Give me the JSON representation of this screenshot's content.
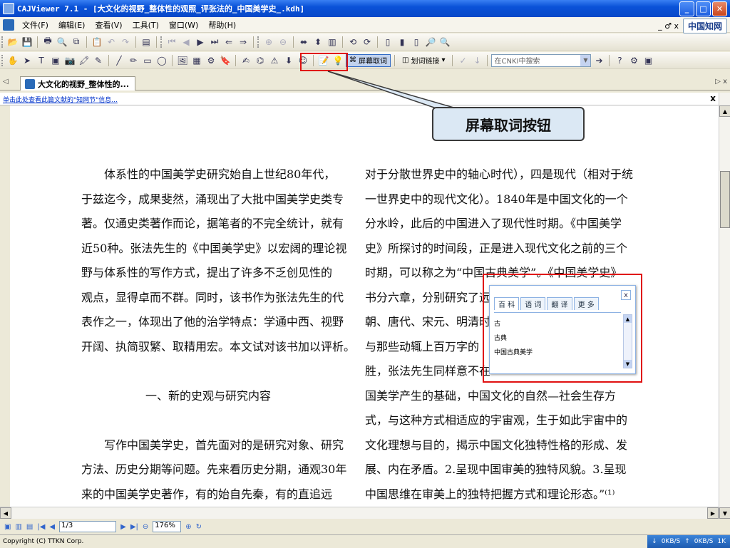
{
  "window": {
    "title": "CAJViewer 7.1 - [大文化的视野_整体性的观照_评张法的_中国美学史_.kdh]",
    "min_label": "_",
    "max_label": "□",
    "close_label": "✕"
  },
  "menu": {
    "items": [
      "文件(F)",
      "编辑(E)",
      "查看(V)",
      "工具(T)",
      "窗口(W)",
      "帮助(H)"
    ],
    "right_controls": "_ ♂ x",
    "cnki_label": "中国知网"
  },
  "toolbar3": {
    "screen_word_label": "屏幕取词",
    "word_link_label": "划词链接",
    "search_placeholder": "在CNKI中搜索"
  },
  "tabs": {
    "active_label": "大文化的视野_整体性的...",
    "left_arrow": "◁",
    "right_controls": "▷ x"
  },
  "infobar": {
    "link_text": "单击此处查看此篇文献的\"知网节\"信息...",
    "close": "x"
  },
  "document": {
    "col1_lines": [
      {
        "text": "体系性的中国美学史研究始自上世纪80年代，",
        "indent": true
      },
      {
        "text": "于兹迄今，成果斐然，涌现出了大批中国美学史类专"
      },
      {
        "text": "著。仅通史类著作而论，据笔者的不完全统计，就有"
      },
      {
        "text": "近50种。张法先生的《中国美学史》以宏阔的理论视"
      },
      {
        "text": "野与体系性的写作方式，提出了许多不乏创见性的"
      },
      {
        "text": "观点，显得卓而不群。同时，该书作为张法先生的代"
      },
      {
        "text": "表作之一，体现出了他的治学特点：学通中西、视野"
      },
      {
        "text": "开阔、执简驭繁、取精用宏。本文试对该书加以评析。"
      }
    ],
    "section_heading": "一、新的史观与研究内容",
    "col1_lines_b": [
      {
        "text": "写作中国美学史，首先面对的是研究对象、研究",
        "indent": true
      },
      {
        "text": "方法、历史分期等问题。先来看历史分期，通观30年"
      },
      {
        "text": "来的中国美学史著作，有的始自先秦，有的直追远"
      }
    ],
    "col2_lines": [
      "对于分散世界史中的轴心时代），四是现代（相对于统",
      "一世界史中的现代文化）。1840年是中国文化的一个",
      "分水岭，此后的中国进入了现代性时期。《中国美学",
      "史》所探讨的时间段，正是进入现代文化之前的三个",
      "时期，可以称之为“中国古典美学”。《中国美学史》",
      "书分六章，分别研究了远",
      "朝、唐代、宋元、明清时期",
      "与那些动辄上百万字的",
      "胜，张法先生同样意不在",
      "国美学产生的基础，中国文化的自然—社会生存方",
      "式，与这种方式相适应的宇宙观，生于如此宇宙中的",
      "文化理想与目的，揭示中国文化独特性格的形成、发",
      "展、内在矛盾。2.呈现中国审美的独特风貌。3.呈现",
      "中国思维在审美上的独特把握方式和理论形态。”⁽¹⁾"
    ]
  },
  "annotation": {
    "callout_text": "屏幕取词按钮",
    "highlight_color": "#e01010"
  },
  "popup": {
    "tabs": [
      "百 科",
      "语 词",
      "翻 译",
      "更 多"
    ],
    "close": "x",
    "items": [
      "古",
      "古典",
      "中国古典美学"
    ]
  },
  "navbar": {
    "page_value": "1/3",
    "zoom_value": "176%"
  },
  "status": {
    "copyright": "Copyright (C) TTKN Corp.",
    "down_speed": "0KB/S",
    "up_speed": "0KB/S",
    "extra": "1K"
  }
}
